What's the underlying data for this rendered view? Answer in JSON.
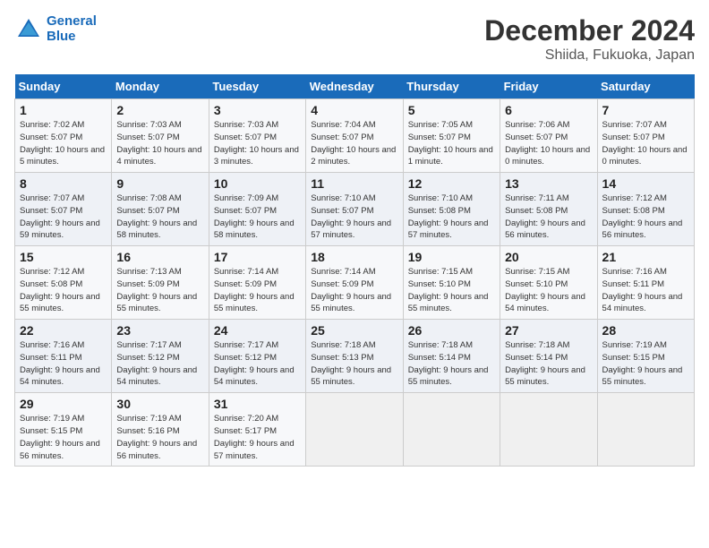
{
  "header": {
    "logo_line1": "General",
    "logo_line2": "Blue",
    "title": "December 2024",
    "subtitle": "Shiida, Fukuoka, Japan"
  },
  "weekdays": [
    "Sunday",
    "Monday",
    "Tuesday",
    "Wednesday",
    "Thursday",
    "Friday",
    "Saturday"
  ],
  "weeks": [
    [
      {
        "day": "1",
        "sunrise": "Sunrise: 7:02 AM",
        "sunset": "Sunset: 5:07 PM",
        "daylight": "Daylight: 10 hours and 5 minutes."
      },
      {
        "day": "2",
        "sunrise": "Sunrise: 7:03 AM",
        "sunset": "Sunset: 5:07 PM",
        "daylight": "Daylight: 10 hours and 4 minutes."
      },
      {
        "day": "3",
        "sunrise": "Sunrise: 7:03 AM",
        "sunset": "Sunset: 5:07 PM",
        "daylight": "Daylight: 10 hours and 3 minutes."
      },
      {
        "day": "4",
        "sunrise": "Sunrise: 7:04 AM",
        "sunset": "Sunset: 5:07 PM",
        "daylight": "Daylight: 10 hours and 2 minutes."
      },
      {
        "day": "5",
        "sunrise": "Sunrise: 7:05 AM",
        "sunset": "Sunset: 5:07 PM",
        "daylight": "Daylight: 10 hours and 1 minute."
      },
      {
        "day": "6",
        "sunrise": "Sunrise: 7:06 AM",
        "sunset": "Sunset: 5:07 PM",
        "daylight": "Daylight: 10 hours and 0 minutes."
      },
      {
        "day": "7",
        "sunrise": "Sunrise: 7:07 AM",
        "sunset": "Sunset: 5:07 PM",
        "daylight": "Daylight: 10 hours and 0 minutes."
      }
    ],
    [
      {
        "day": "8",
        "sunrise": "Sunrise: 7:07 AM",
        "sunset": "Sunset: 5:07 PM",
        "daylight": "Daylight: 9 hours and 59 minutes."
      },
      {
        "day": "9",
        "sunrise": "Sunrise: 7:08 AM",
        "sunset": "Sunset: 5:07 PM",
        "daylight": "Daylight: 9 hours and 58 minutes."
      },
      {
        "day": "10",
        "sunrise": "Sunrise: 7:09 AM",
        "sunset": "Sunset: 5:07 PM",
        "daylight": "Daylight: 9 hours and 58 minutes."
      },
      {
        "day": "11",
        "sunrise": "Sunrise: 7:10 AM",
        "sunset": "Sunset: 5:07 PM",
        "daylight": "Daylight: 9 hours and 57 minutes."
      },
      {
        "day": "12",
        "sunrise": "Sunrise: 7:10 AM",
        "sunset": "Sunset: 5:08 PM",
        "daylight": "Daylight: 9 hours and 57 minutes."
      },
      {
        "day": "13",
        "sunrise": "Sunrise: 7:11 AM",
        "sunset": "Sunset: 5:08 PM",
        "daylight": "Daylight: 9 hours and 56 minutes."
      },
      {
        "day": "14",
        "sunrise": "Sunrise: 7:12 AM",
        "sunset": "Sunset: 5:08 PM",
        "daylight": "Daylight: 9 hours and 56 minutes."
      }
    ],
    [
      {
        "day": "15",
        "sunrise": "Sunrise: 7:12 AM",
        "sunset": "Sunset: 5:08 PM",
        "daylight": "Daylight: 9 hours and 55 minutes."
      },
      {
        "day": "16",
        "sunrise": "Sunrise: 7:13 AM",
        "sunset": "Sunset: 5:09 PM",
        "daylight": "Daylight: 9 hours and 55 minutes."
      },
      {
        "day": "17",
        "sunrise": "Sunrise: 7:14 AM",
        "sunset": "Sunset: 5:09 PM",
        "daylight": "Daylight: 9 hours and 55 minutes."
      },
      {
        "day": "18",
        "sunrise": "Sunrise: 7:14 AM",
        "sunset": "Sunset: 5:09 PM",
        "daylight": "Daylight: 9 hours and 55 minutes."
      },
      {
        "day": "19",
        "sunrise": "Sunrise: 7:15 AM",
        "sunset": "Sunset: 5:10 PM",
        "daylight": "Daylight: 9 hours and 55 minutes."
      },
      {
        "day": "20",
        "sunrise": "Sunrise: 7:15 AM",
        "sunset": "Sunset: 5:10 PM",
        "daylight": "Daylight: 9 hours and 54 minutes."
      },
      {
        "day": "21",
        "sunrise": "Sunrise: 7:16 AM",
        "sunset": "Sunset: 5:11 PM",
        "daylight": "Daylight: 9 hours and 54 minutes."
      }
    ],
    [
      {
        "day": "22",
        "sunrise": "Sunrise: 7:16 AM",
        "sunset": "Sunset: 5:11 PM",
        "daylight": "Daylight: 9 hours and 54 minutes."
      },
      {
        "day": "23",
        "sunrise": "Sunrise: 7:17 AM",
        "sunset": "Sunset: 5:12 PM",
        "daylight": "Daylight: 9 hours and 54 minutes."
      },
      {
        "day": "24",
        "sunrise": "Sunrise: 7:17 AM",
        "sunset": "Sunset: 5:12 PM",
        "daylight": "Daylight: 9 hours and 54 minutes."
      },
      {
        "day": "25",
        "sunrise": "Sunrise: 7:18 AM",
        "sunset": "Sunset: 5:13 PM",
        "daylight": "Daylight: 9 hours and 55 minutes."
      },
      {
        "day": "26",
        "sunrise": "Sunrise: 7:18 AM",
        "sunset": "Sunset: 5:14 PM",
        "daylight": "Daylight: 9 hours and 55 minutes."
      },
      {
        "day": "27",
        "sunrise": "Sunrise: 7:18 AM",
        "sunset": "Sunset: 5:14 PM",
        "daylight": "Daylight: 9 hours and 55 minutes."
      },
      {
        "day": "28",
        "sunrise": "Sunrise: 7:19 AM",
        "sunset": "Sunset: 5:15 PM",
        "daylight": "Daylight: 9 hours and 55 minutes."
      }
    ],
    [
      {
        "day": "29",
        "sunrise": "Sunrise: 7:19 AM",
        "sunset": "Sunset: 5:15 PM",
        "daylight": "Daylight: 9 hours and 56 minutes."
      },
      {
        "day": "30",
        "sunrise": "Sunrise: 7:19 AM",
        "sunset": "Sunset: 5:16 PM",
        "daylight": "Daylight: 9 hours and 56 minutes."
      },
      {
        "day": "31",
        "sunrise": "Sunrise: 7:20 AM",
        "sunset": "Sunset: 5:17 PM",
        "daylight": "Daylight: 9 hours and 57 minutes."
      },
      null,
      null,
      null,
      null
    ]
  ]
}
